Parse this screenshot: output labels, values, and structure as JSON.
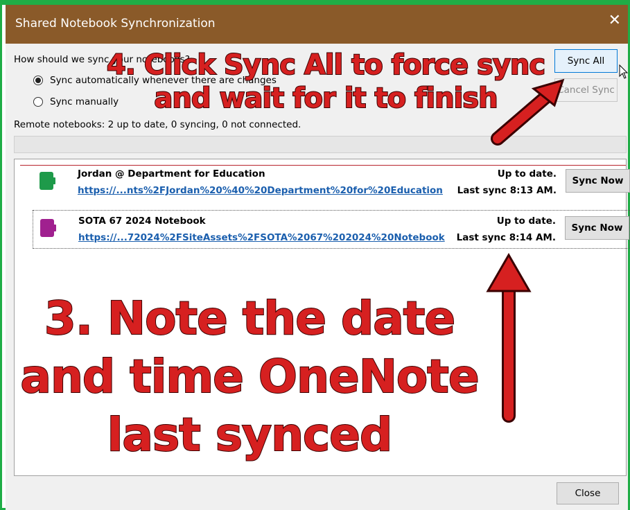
{
  "dialog": {
    "title": "Shared Notebook Synchronization",
    "close_glyph": "✕",
    "question": "How should we sync your notebooks?",
    "options": [
      {
        "label": "Sync automatically whenever there are changes",
        "selected": true
      },
      {
        "label": "Sync manually",
        "selected": false
      }
    ],
    "status": "Remote notebooks: 2 up to date, 0 syncing, 0 not connected.",
    "sync_all_label": "Sync All",
    "cancel_sync_label": "Cancel Sync",
    "close_button_label": "Close"
  },
  "notebooks": [
    {
      "name": "Jordan @ Department for Education",
      "url": "https://...nts%2FJordan%20%40%20Department%20for%20Education",
      "status": "Up to date.",
      "last_sync": "Last sync 8:13 AM.",
      "button": "Sync Now",
      "icon": "green-notebook-icon",
      "color": "#1e9a4a"
    },
    {
      "name": "SOTA 67 2024 Notebook",
      "url": "https://...72024%2FSiteAssets%2FSOTA%2067%202024%20Notebook",
      "status": "Up to date.",
      "last_sync": "Last sync 8:14 AM.",
      "button": "Sync Now",
      "icon": "purple-notebook-icon",
      "color": "#a0208f"
    }
  ],
  "annotations": {
    "step4": [
      "4. Click Sync All to force sync",
      "and wait for it to finish"
    ],
    "step3": [
      "3. Note the date",
      "and time OneNote",
      "last synced"
    ]
  },
  "colors": {
    "titlebar": "#8a5a29",
    "frame": "#1fad46",
    "annotation": "#d62020",
    "link": "#1b5fae"
  }
}
